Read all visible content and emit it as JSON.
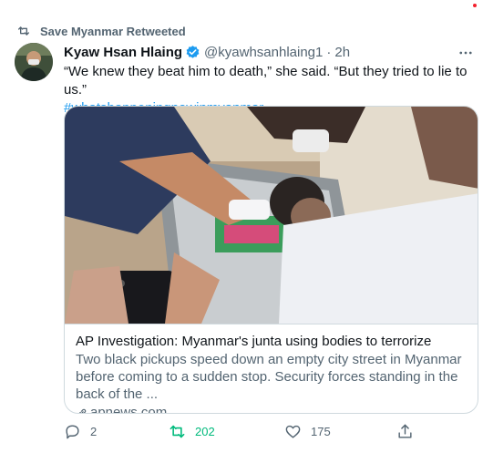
{
  "retweet": {
    "label": "Save Myanmar Retweeted"
  },
  "tweet": {
    "display_name": "Kyaw Hsan Hlaing",
    "handle": "@kyawhsanhlaing1",
    "separator": "·",
    "time": "2h",
    "text": "“We knew they beat him to death,” she said. “But they tried to lie to us.”",
    "hashtag": "#whatshappeningnowinmyanmar"
  },
  "card": {
    "title": "AP Investigation: Myanmar's junta using bodies to terrorize",
    "description": "Two black pickups speed down an empty city street in Myanmar before coming to a sudden stop. Security forces standing in the back of the ...",
    "domain": "apnews.com"
  },
  "actions": {
    "replies": "2",
    "retweets": "202",
    "likes": "175"
  },
  "colors": {
    "accent": "#1d9bf0",
    "retweet_active": "#00ba7c",
    "muted": "#536471"
  },
  "icons": [
    "retweet-icon",
    "verified-badge-icon",
    "more-icon",
    "link-icon",
    "reply-icon",
    "retweet-icon",
    "like-icon",
    "share-icon"
  ]
}
